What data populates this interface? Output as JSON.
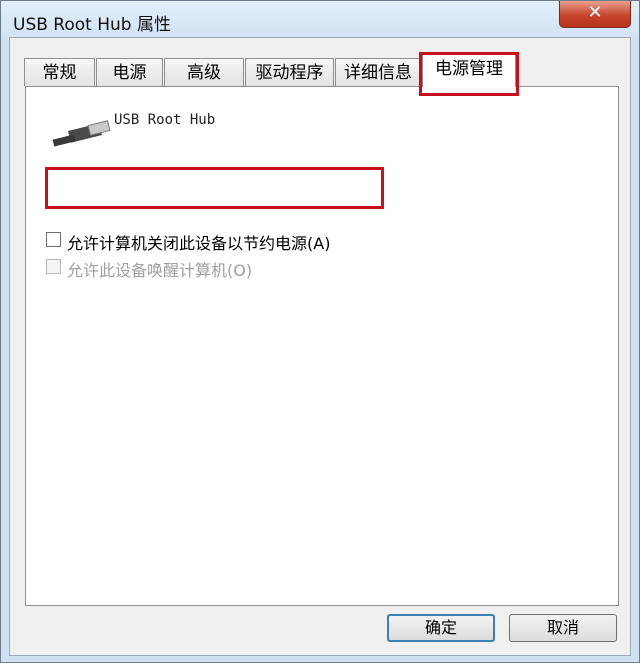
{
  "window": {
    "title": "USB Root Hub 属性",
    "close_label": "✕"
  },
  "tabs": [
    {
      "label": "常规"
    },
    {
      "label": "电源"
    },
    {
      "label": "高级"
    },
    {
      "label": "驱动程序"
    },
    {
      "label": "详细信息"
    },
    {
      "label": "电源管理",
      "active": true
    }
  ],
  "panel": {
    "device_name": "USB Root Hub",
    "device_icon": "usb-plug-icon",
    "options": [
      {
        "label": "允许计算机关闭此设备以节约电源(A)",
        "checked": false,
        "enabled": true
      },
      {
        "label": "允许此设备唤醒计算机(O)",
        "checked": false,
        "enabled": false
      }
    ]
  },
  "buttons": {
    "ok": "确定",
    "cancel": "取消"
  },
  "colors": {
    "highlight": "#c8101c",
    "title_bar": "#d3e3f4",
    "close": "#c7452d"
  }
}
